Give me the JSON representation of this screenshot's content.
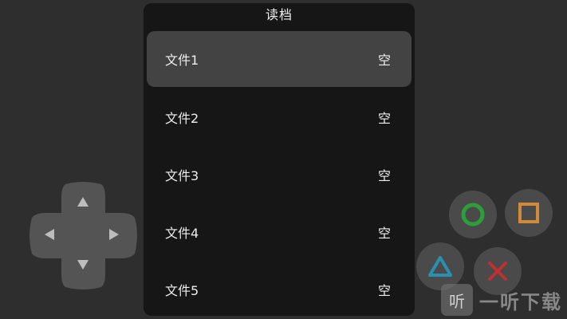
{
  "dialog": {
    "title": "读档",
    "slots": [
      {
        "name": "文件1",
        "status": "空",
        "selected": true
      },
      {
        "name": "文件2",
        "status": "空",
        "selected": false
      },
      {
        "name": "文件3",
        "status": "空",
        "selected": false
      },
      {
        "name": "文件4",
        "status": "空",
        "selected": false
      },
      {
        "name": "文件5",
        "status": "空",
        "selected": false
      }
    ]
  },
  "controls": {
    "dpad_icons": [
      "arrow-up-icon",
      "arrow-down-icon",
      "arrow-left-icon",
      "arrow-right-icon"
    ],
    "buttons": [
      {
        "icon": "circle-icon",
        "color": "#2e9e3a"
      },
      {
        "icon": "square-icon",
        "color": "#d08a3a"
      },
      {
        "icon": "triangle-icon",
        "color": "#2a8fb0"
      },
      {
        "icon": "cross-icon",
        "color": "#c03030"
      }
    ]
  },
  "watermark": {
    "logo_text": "听",
    "text": "一听下载"
  },
  "colors": {
    "background": "#2e2e2e",
    "dialog": "#161616",
    "selected_row": "#434343"
  }
}
